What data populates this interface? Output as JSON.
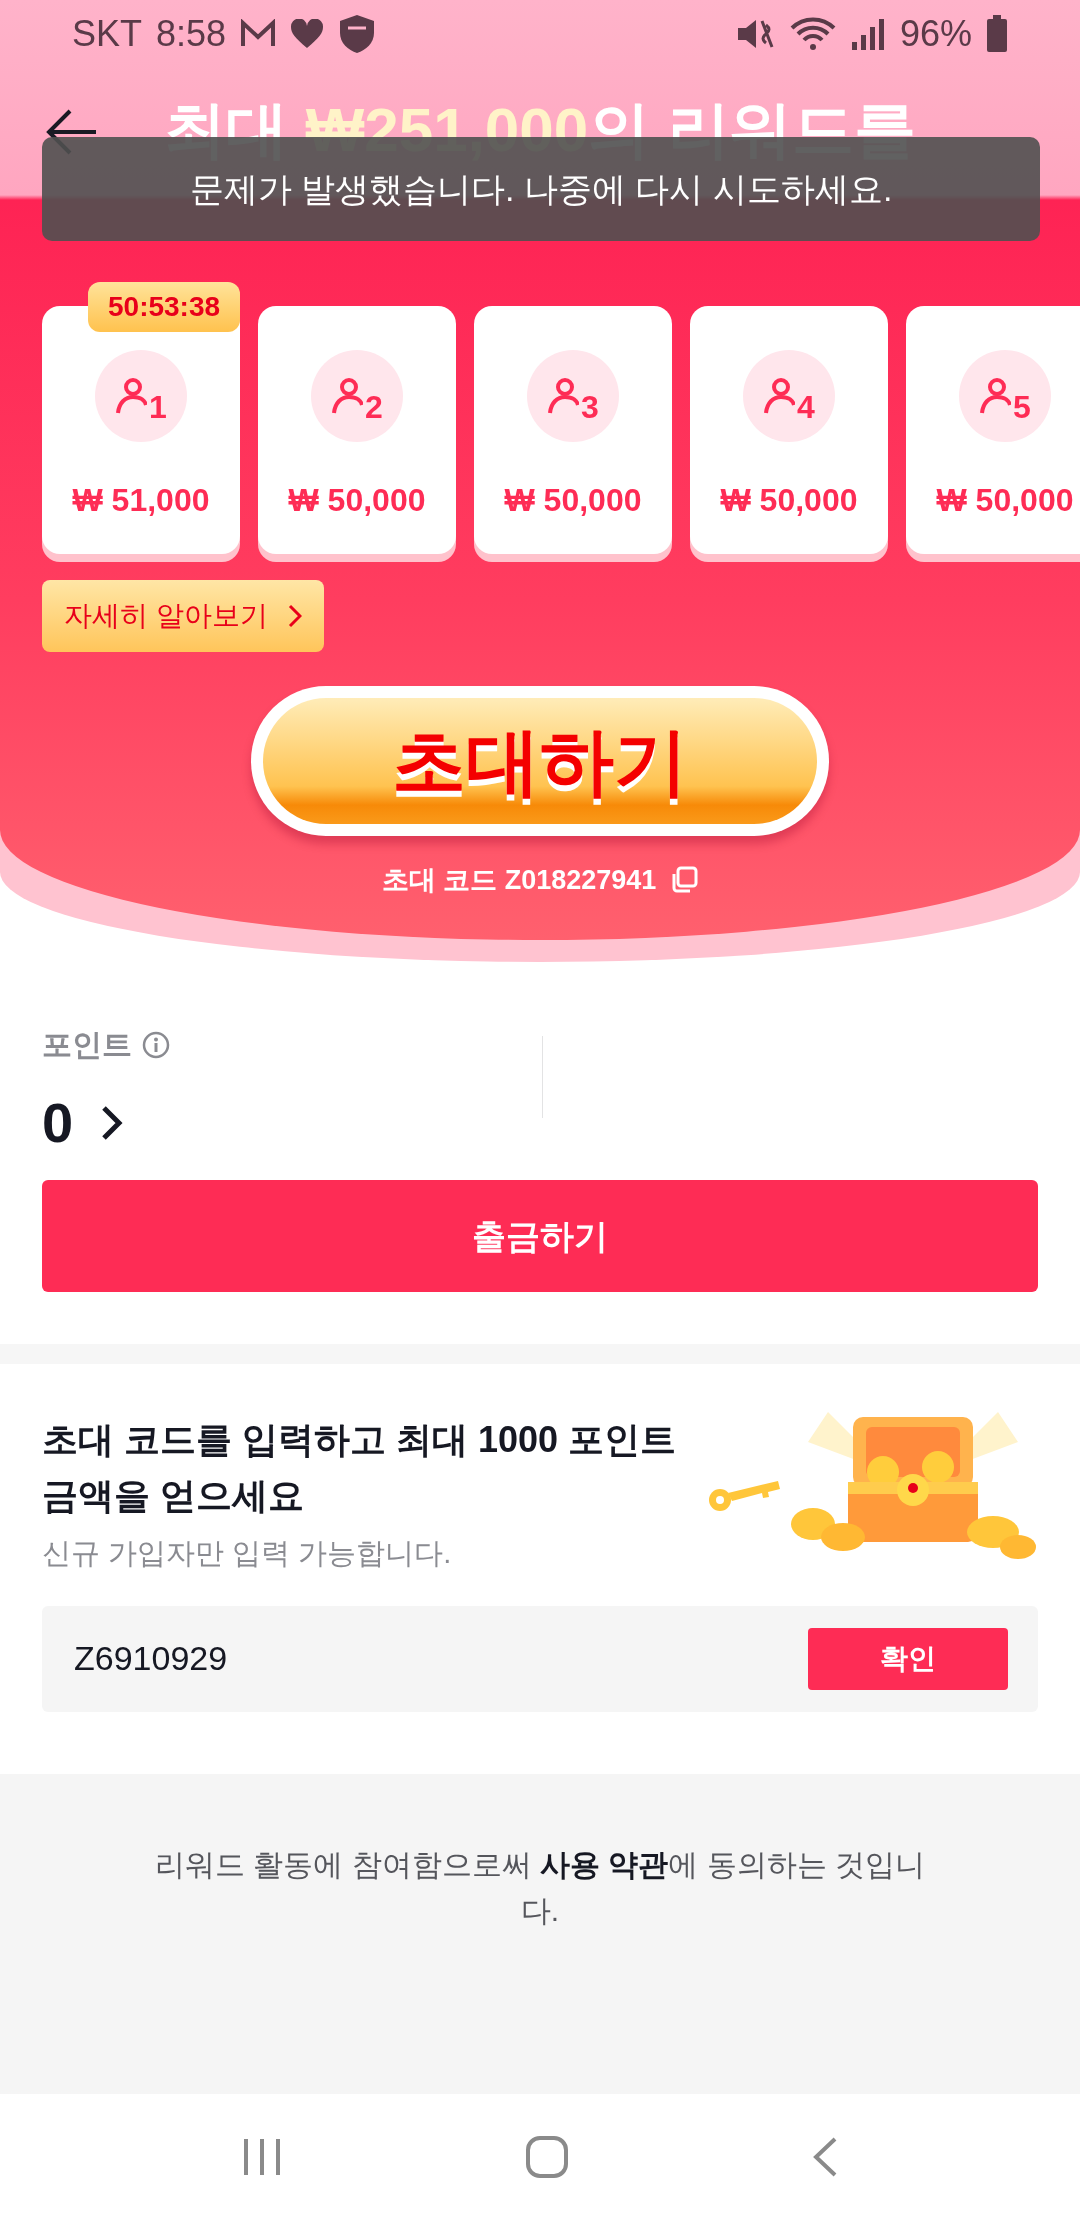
{
  "status_bar": {
    "carrier": "SKT",
    "time": "8:58",
    "battery": "96%"
  },
  "header": {
    "headline_prefix": "최대 ",
    "headline_amount": "₩251,000",
    "headline_suffix": "의 리워드를"
  },
  "toast": "문제가 발생했습니다. 나중에 다시 시도하세요.",
  "reward_cards": [
    {
      "number": "1",
      "amount": "₩ 51,000",
      "timer": "50:53:38"
    },
    {
      "number": "2",
      "amount": "₩ 50,000"
    },
    {
      "number": "3",
      "amount": "₩ 50,000"
    },
    {
      "number": "4",
      "amount": "₩ 50,000"
    },
    {
      "number": "5",
      "amount": "₩ 50,000"
    }
  ],
  "learn_more": "자세히 알아보기",
  "invite_button": "초대하기",
  "invite_code": "초대 코드 Z018227941",
  "points": {
    "label": "포인트",
    "value": "0"
  },
  "withdraw_button": "출금하기",
  "enter_code": {
    "title": "초대 코드를 입력하고 최대 1000 포인트 금액을 얻으세요",
    "subtitle": "신규 가입자만 입력 가능합니다.",
    "value": "Z6910929",
    "confirm": "확인"
  },
  "footer": {
    "before": "리워드 활동에 참여함으로써 ",
    "link": "사용 약관",
    "after": "에 동의하는 것입니다."
  }
}
